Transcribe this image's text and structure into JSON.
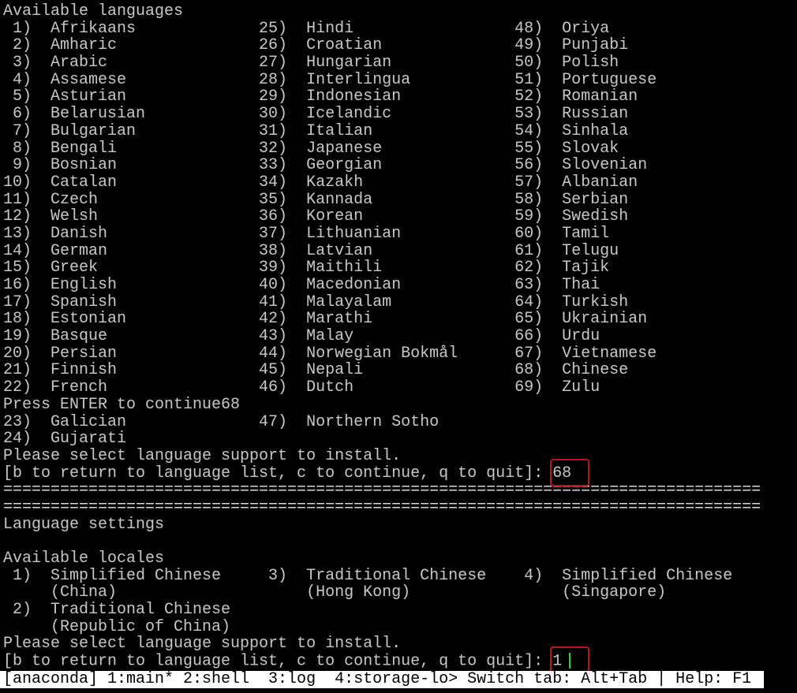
{
  "terminal": {
    "lines": [
      "Available languages",
      " 1)  Afrikaans             25)  Hindi                 48)  Oriya",
      " 2)  Amharic               26)  Croatian              49)  Punjabi",
      " 3)  Arabic                27)  Hungarian             50)  Polish",
      " 4)  Assamese              28)  Interlingua           51)  Portuguese",
      " 5)  Asturian              29)  Indonesian            52)  Romanian",
      " 6)  Belarusian            30)  Icelandic             53)  Russian",
      " 7)  Bulgarian             31)  Italian               54)  Sinhala",
      " 8)  Bengali               32)  Japanese              55)  Slovak",
      " 9)  Bosnian               33)  Georgian              56)  Slovenian",
      "10)  Catalan               34)  Kazakh                57)  Albanian",
      "11)  Czech                 35)  Kannada               58)  Serbian",
      "12)  Welsh                 36)  Korean                59)  Swedish",
      "13)  Danish                37)  Lithuanian            60)  Tamil",
      "14)  German                38)  Latvian               61)  Telugu",
      "15)  Greek                 39)  Maithili              62)  Tajik",
      "16)  English               40)  Macedonian            63)  Thai",
      "17)  Spanish               41)  Malayalam             64)  Turkish",
      "18)  Estonian              42)  Marathi               65)  Ukrainian",
      "19)  Basque                43)  Malay                 66)  Urdu",
      "20)  Persian               44)  Norwegian Bokmål      67)  Vietnamese",
      "21)  Finnish               45)  Nepali                68)  Chinese",
      "22)  French                46)  Dutch                 69)  Zulu",
      "Press ENTER to continue68",
      "23)  Galician              47)  Northern Sotho",
      "24)  Gujarati",
      "Please select language support to install."
    ],
    "prompt1": "[b to return to language list, c to continue, q to quit]: ",
    "input1": "68",
    "separator": "================================================================================",
    "lines2": [
      "Language settings",
      "",
      "Available locales",
      " 1)  Simplified Chinese     3)  Traditional Chinese    4)  Simplified Chinese",
      "     (China)                    (Hong Kong)                (Singapore)",
      " 2)  Traditional Chinese",
      "     (Republic of China)",
      "Please select language support to install."
    ],
    "prompt2": "[b to return to language list, c to continue, q to quit]: ",
    "input2": "1"
  },
  "status_bar": {
    "text": "[anaconda] 1:main* 2:shell  3:log  4:storage-lo> Switch tab: Alt+Tab | Help: F1"
  },
  "colors": {
    "text": "#c8c8c8",
    "background": "#000000",
    "highlight_box": "#c0121a",
    "cursor": "#22e022"
  }
}
